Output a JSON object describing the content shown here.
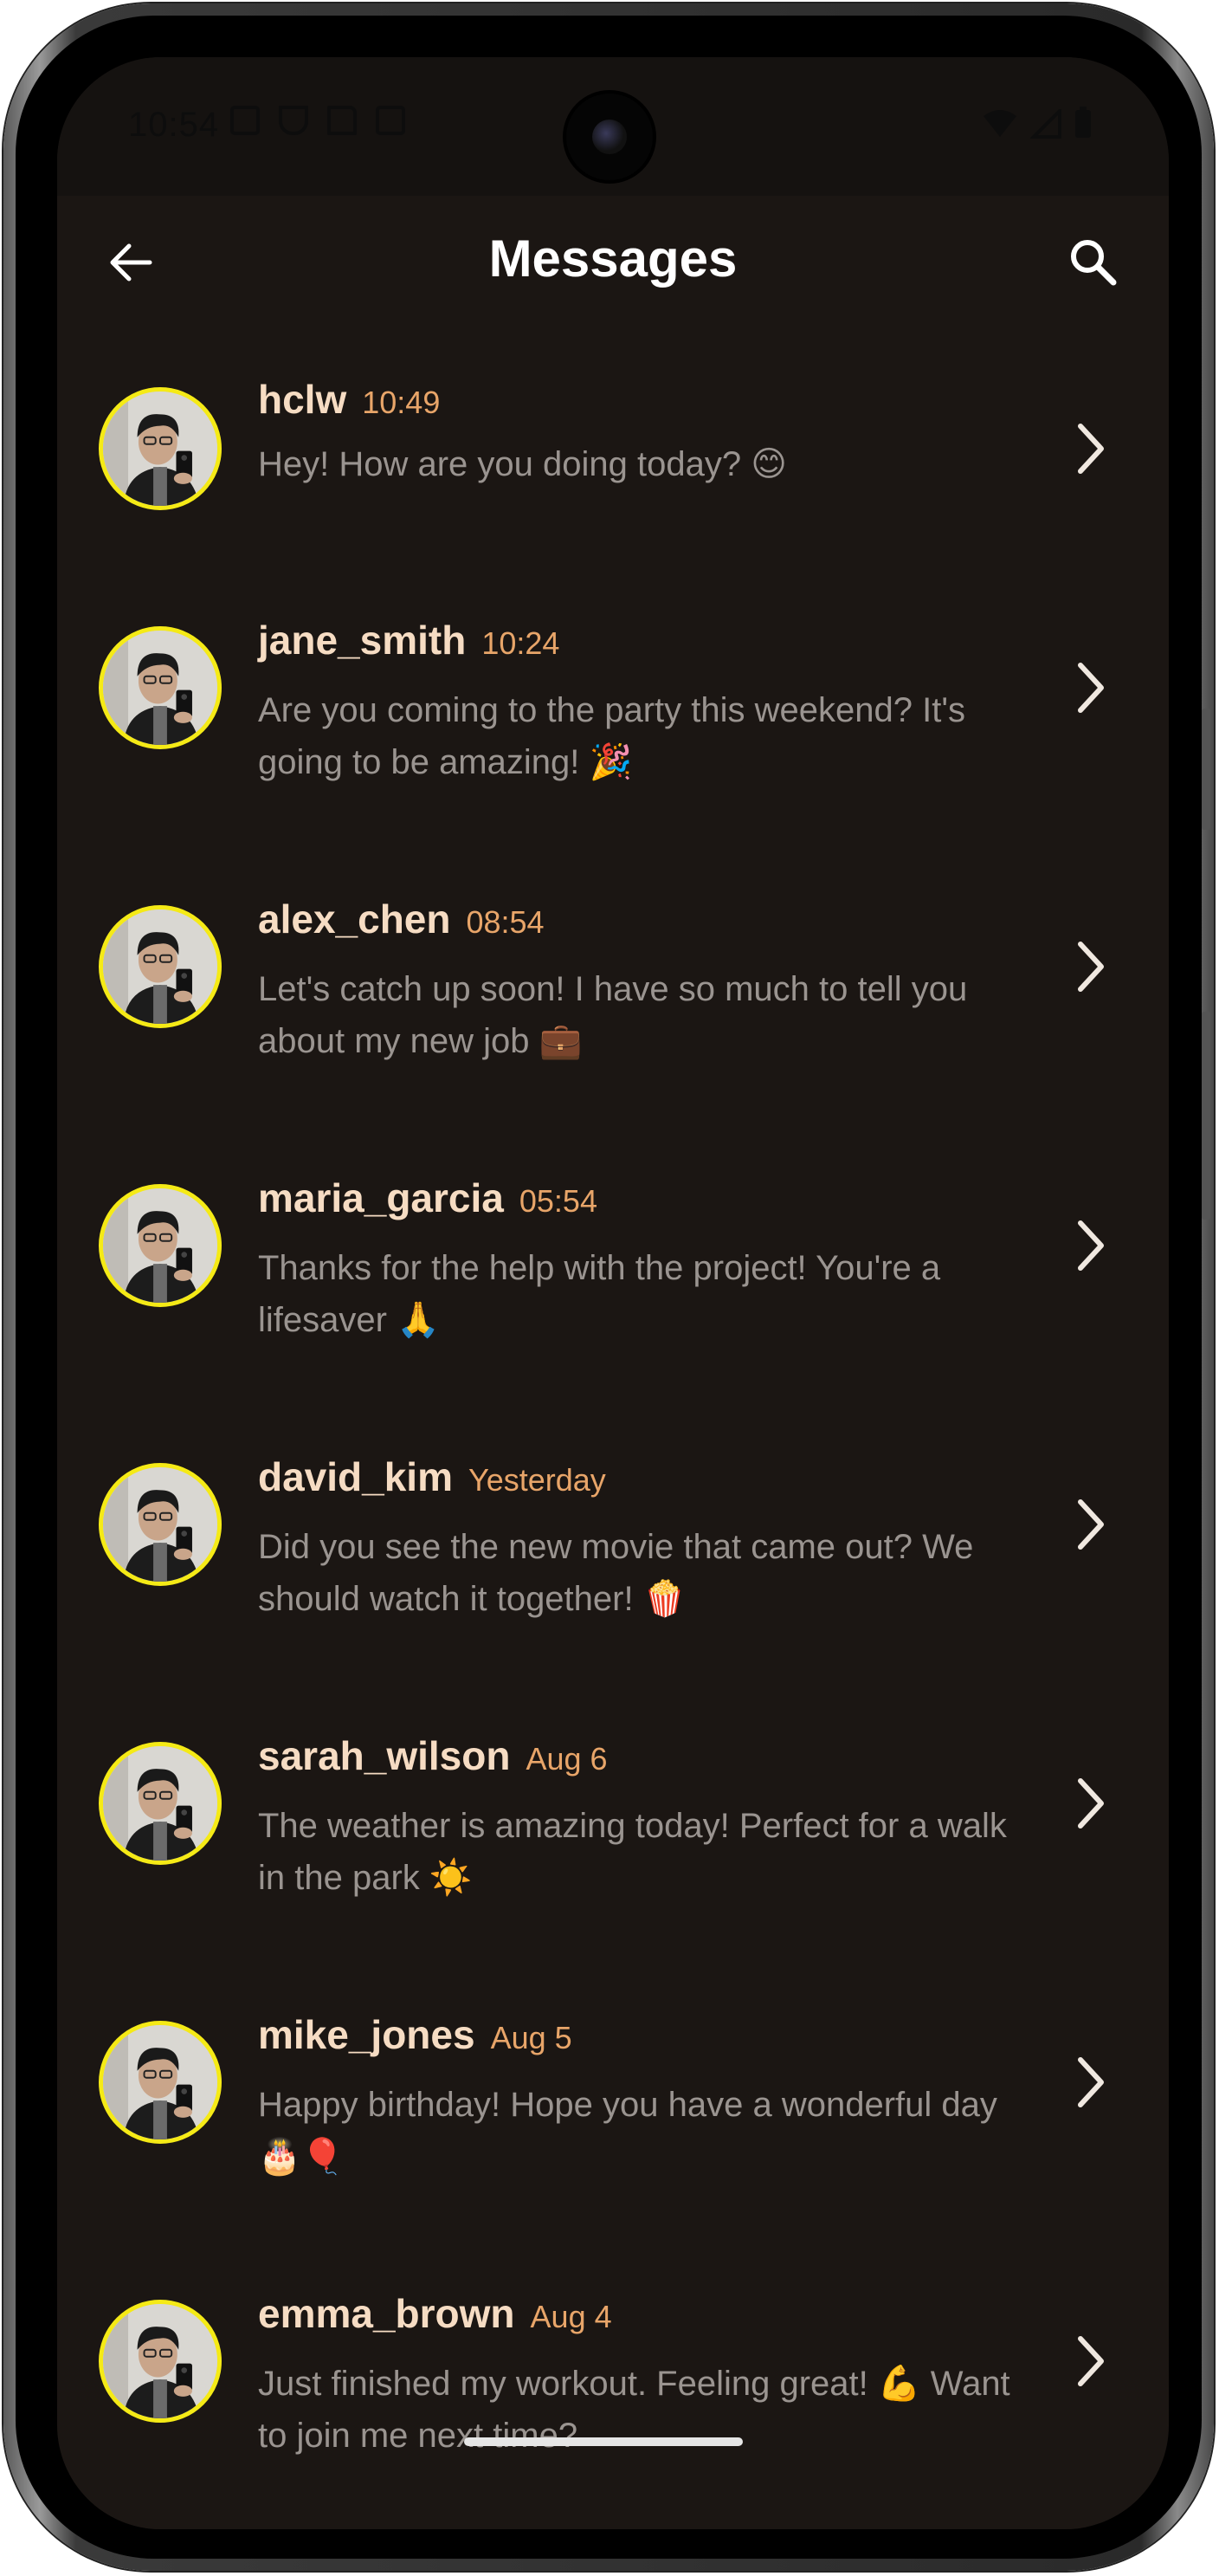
{
  "status_bar": {
    "time": "10:54"
  },
  "header": {
    "title": "Messages"
  },
  "colors": {
    "background": "#1b1613",
    "username": "#f6dcc3",
    "timestamp": "#e8a569",
    "preview": "#9a9490",
    "avatar_ring": "#f5ea16"
  },
  "conversations": [
    {
      "username": "hclw",
      "time": "10:49",
      "preview": "Hey! How are you doing today? 😊"
    },
    {
      "username": "jane_smith",
      "time": "10:24",
      "preview": "Are you coming to the party this weekend? It's going to be amazing! 🎉"
    },
    {
      "username": "alex_chen",
      "time": "08:54",
      "preview": "Let's catch up soon! I have so much to tell you about my new job 💼"
    },
    {
      "username": "maria_garcia",
      "time": "05:54",
      "preview": "Thanks for the help with the project! You're a lifesaver 🙏"
    },
    {
      "username": "david_kim",
      "time": "Yesterday",
      "preview": "Did you see the new movie that came out? We should watch it together! 🍿"
    },
    {
      "username": "sarah_wilson",
      "time": "Aug 6",
      "preview": "The weather is amazing today! Perfect for a walk in the park ☀️"
    },
    {
      "username": "mike_jones",
      "time": "Aug 5",
      "preview": "Happy birthday! Hope you have a wonderful day 🎂🎈"
    },
    {
      "username": "emma_brown",
      "time": "Aug 4",
      "preview": "Just finished my workout. Feeling great! 💪 Want to join me next time?"
    }
  ]
}
